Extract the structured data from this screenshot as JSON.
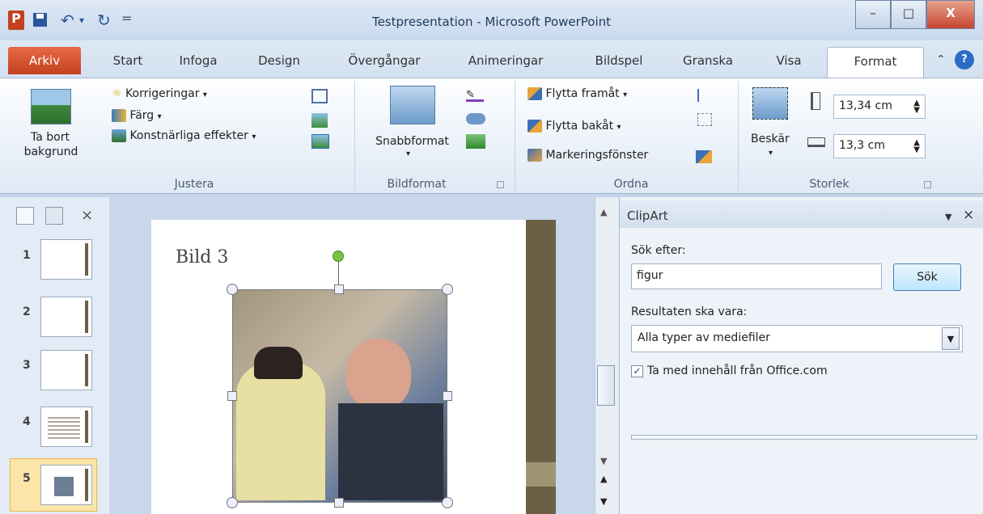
{
  "window": {
    "title": "Testpresentation - Microsoft PowerPoint",
    "minimize": "–",
    "restore": "□",
    "close": "X"
  },
  "qat": {
    "app_icon": "P",
    "save_icon": "floppy-disk",
    "undo": "↶",
    "redo": "↻",
    "customize": "="
  },
  "tabs": [
    "Arkiv",
    "Start",
    "Infoga",
    "Design",
    "Övergångar",
    "Animeringar",
    "Bildspel",
    "Granska",
    "Visa",
    "Format"
  ],
  "ribbon": {
    "remove_bg": {
      "line1": "Ta bort",
      "line2": "bakgrund"
    },
    "corrections": "Korrigeringar",
    "color": "Färg",
    "artistic": "Konstnärliga effekter",
    "quickstyles": "Snabbformat",
    "bring_forward": "Flytta framåt",
    "send_backward": "Flytta bakåt",
    "selection_pane": "Markeringsfönster",
    "crop": "Beskär",
    "height": "13,34 cm",
    "width": "13,3 cm",
    "groups": {
      "adjust": "Justera",
      "picture_styles": "Bildformat",
      "arrange": "Ordna",
      "size": "Storlek"
    },
    "dropdown_arrow": "▾"
  },
  "slides": {
    "numbers": [
      "1",
      "2",
      "3",
      "4",
      "5"
    ],
    "selected": 5
  },
  "slide": {
    "title": "Bild 3"
  },
  "clipart": {
    "pane_title": "ClipArt",
    "search_label": "Sök efter:",
    "search_value": "figur",
    "search_button": "Sök",
    "results_label": "Resultaten ska vara:",
    "results_value": "Alla typer av mediefiler",
    "include_office": "Ta med innehåll från Office.com",
    "include_checked": true
  },
  "colors": {
    "accent": "#c4401f",
    "ribbon_bg": "#dfe9f5",
    "slide_stripe": "#6b5f44"
  }
}
